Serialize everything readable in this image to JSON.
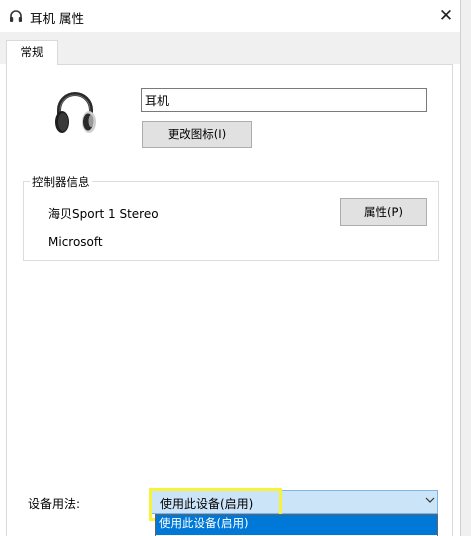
{
  "window": {
    "title": "耳机 属性",
    "close_label": "✕"
  },
  "tabs": [
    {
      "label": "常规",
      "selected": true
    }
  ],
  "general": {
    "device_name": "耳机",
    "change_icon_label": "更改图标(I)"
  },
  "controller": {
    "legend": "控制器信息",
    "name": "海贝Sport 1 Stereo",
    "manufacturer": "Microsoft",
    "properties_label": "属性(P)"
  },
  "usage": {
    "label": "设备用法:",
    "selected_value": "使用此设备(启用)",
    "options": [
      "使用此设备(启用)"
    ]
  },
  "icons": {
    "title": "headphone-icon",
    "device": "headphone-icon",
    "dropdown": "chevron-down-icon"
  },
  "colors": {
    "highlight": "#f7f23a",
    "selection": "#0078d7",
    "select_focus": "#cce4f7"
  }
}
